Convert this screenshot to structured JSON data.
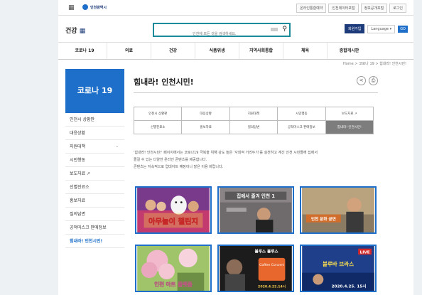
{
  "util": {
    "grid_glyph": "▦",
    "logo_text": "인천광역시",
    "links": [
      "온라인통합예약",
      "인천데이터포털",
      "정보공개포털",
      "로그인"
    ]
  },
  "header": {
    "site_title": "건강",
    "menu_glyph": "▦",
    "search_placeholder": "인천에 모든 것을 검색하세요.",
    "join_label": "회원가입",
    "lang_label": "Language ▾",
    "go_label": "GO"
  },
  "gnb": [
    "코로나 19",
    "의료",
    "건강",
    "식품위생",
    "지역사회통합",
    "체육",
    "종합게시판"
  ],
  "breadcrumb": "Home  >  코로나 19  >  힘내라! 인천시민!",
  "lnb": {
    "title": "코로나 19",
    "items": [
      {
        "label": "인천시 상황판"
      },
      {
        "label": "대응상황"
      },
      {
        "label": "지원대책"
      },
      {
        "label": "시민행동"
      },
      {
        "label": "보도자료 ↗"
      },
      {
        "label": "선별진료소"
      },
      {
        "label": "홍보자료"
      },
      {
        "label": "질의답변"
      },
      {
        "label": "공적마스크 판매정보"
      },
      {
        "label": "힘내라! 인천시민!"
      }
    ]
  },
  "content": {
    "title": "힘내라! 인천시민!",
    "tabs": [
      "인천시 상황판",
      "대응상황",
      "지원대책",
      "시민행동",
      "보도자료 ↗",
      "선별진료소",
      "홍보자료",
      "질의답변",
      "공적마스크 판매정보",
      "힘내라! 인천시민!"
    ],
    "intro_line1": "'힘내라! 인천시민!' 페이지에서는 코로나19 극복을 위해 강도 높은 '사회적 거리두기'를 실천하고 계신 인천 시민들께 집에서",
    "intro_line2": "즐길 수 있는 다양한 온라인 콘텐츠를 제공합니다.",
    "intro_line3": "콘텐츠는 지속적으로 업데이트 예정이니 많은 이용 바랍니다.",
    "thumbs": [
      {
        "caption": "아무놀이 챌린지"
      },
      {
        "caption": "집에서 즐겨 인천 1"
      },
      {
        "caption": "인천 문화 공연"
      },
      {
        "caption": "인천 아트 플랫폼"
      },
      {
        "caption": "블루스 블루스",
        "sub": "Coffee Concert",
        "date": "2020.4.22.14시"
      },
      {
        "caption": "블루바 브라스",
        "date": "2020.4.25. 15시",
        "badge": "LIVE"
      }
    ]
  },
  "colors": {
    "accent": "#1d6fc9",
    "navy": "#1d3b7a",
    "search_border": "#1b8a9a"
  }
}
